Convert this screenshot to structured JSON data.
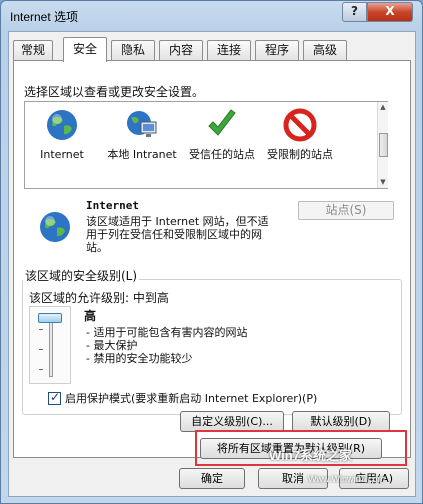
{
  "window": {
    "title": "Internet 选项",
    "help_glyph": "?",
    "close_glyph": "X"
  },
  "tabs": [
    "常规",
    "安全",
    "隐私",
    "内容",
    "连接",
    "程序",
    "高级"
  ],
  "active_tab": "安全",
  "zones": {
    "prompt": "选择区域以查看或更改安全设置。",
    "items": [
      {
        "label": "Internet",
        "icon": "globe-icon"
      },
      {
        "label": "本地 Intranet",
        "icon": "intranet-icon"
      },
      {
        "label": "受信任的站点",
        "icon": "checkmark-icon"
      },
      {
        "label": "受限制的站点",
        "icon": "no-entry-icon"
      }
    ]
  },
  "selected_zone": {
    "title": "Internet",
    "description": "该区域适用于 Internet 网站，但不适用于列在受信任和受限制区域中的网站。",
    "sites_button": "站点(S)"
  },
  "security_level": {
    "group_title": "该区域的安全级别(L)",
    "allowed_levels": "该区域的允许级别: 中到高",
    "level_name": "高",
    "level_items": [
      "- 适用于可能包含有害内容的网站",
      "- 最大保护",
      "- 禁用的安全功能较少"
    ],
    "protected_mode_label": "启用保护模式(要求重新启动 Internet Explorer)(P)",
    "protected_mode_checked": true,
    "custom_level_button": "自定义级别(C)...",
    "default_level_button": "默认级别(D)"
  },
  "reset_all_button": "将所有区域重置为默认级别(R)",
  "footer": {
    "ok_button": "确定",
    "cancel_button": "取消",
    "apply_button": "应用(A)"
  },
  "watermark": {
    "text": "Win7系统之家",
    "sub": "Www.Winwin7.com"
  },
  "colors": {
    "highlight_frame": "#e0353a",
    "title_bar": "#b9d0e8"
  }
}
